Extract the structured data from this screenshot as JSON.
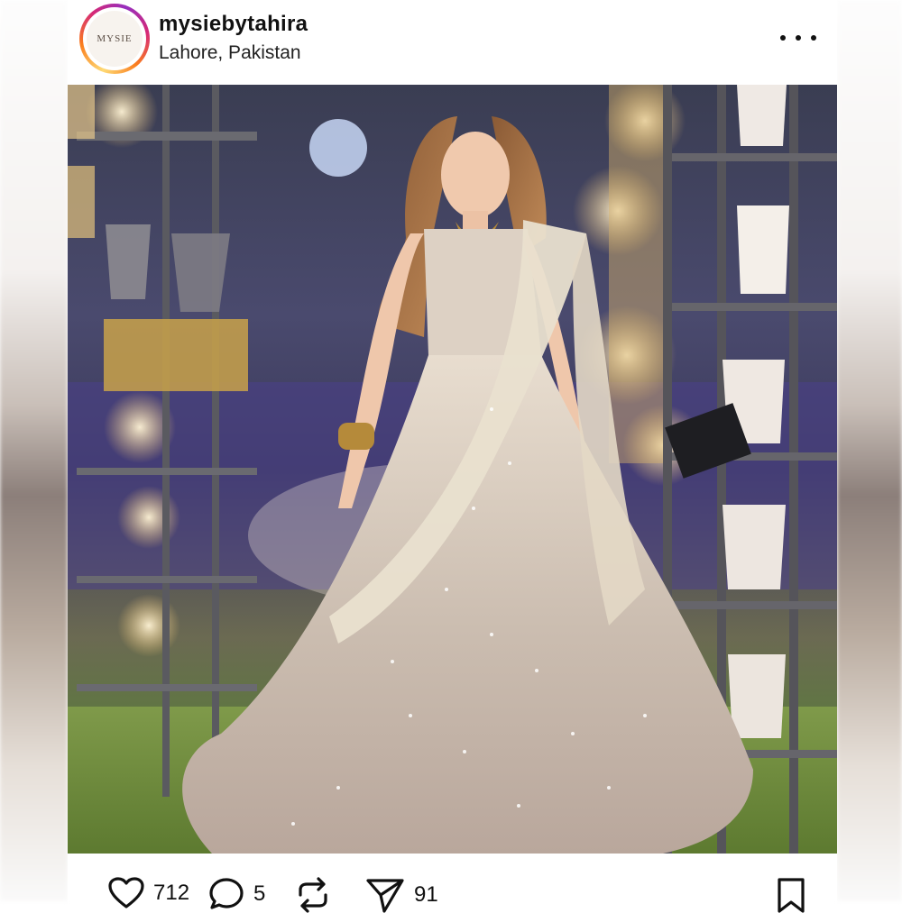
{
  "post": {
    "username": "mysiebytahira",
    "location": "Lahore, Pakistan",
    "avatar_text": "MYSIE"
  },
  "actions": {
    "likes": "712",
    "comments": "5",
    "shares": "91"
  },
  "icons": {
    "more": "more-horizontal-icon",
    "like": "heart-icon",
    "comment": "comment-bubble-icon",
    "repost": "repost-icon",
    "share": "send-icon",
    "save": "bookmark-icon"
  },
  "colors": {
    "story_ring_start": "#feda75",
    "story_ring_end": "#d62976",
    "text": "#111111"
  }
}
